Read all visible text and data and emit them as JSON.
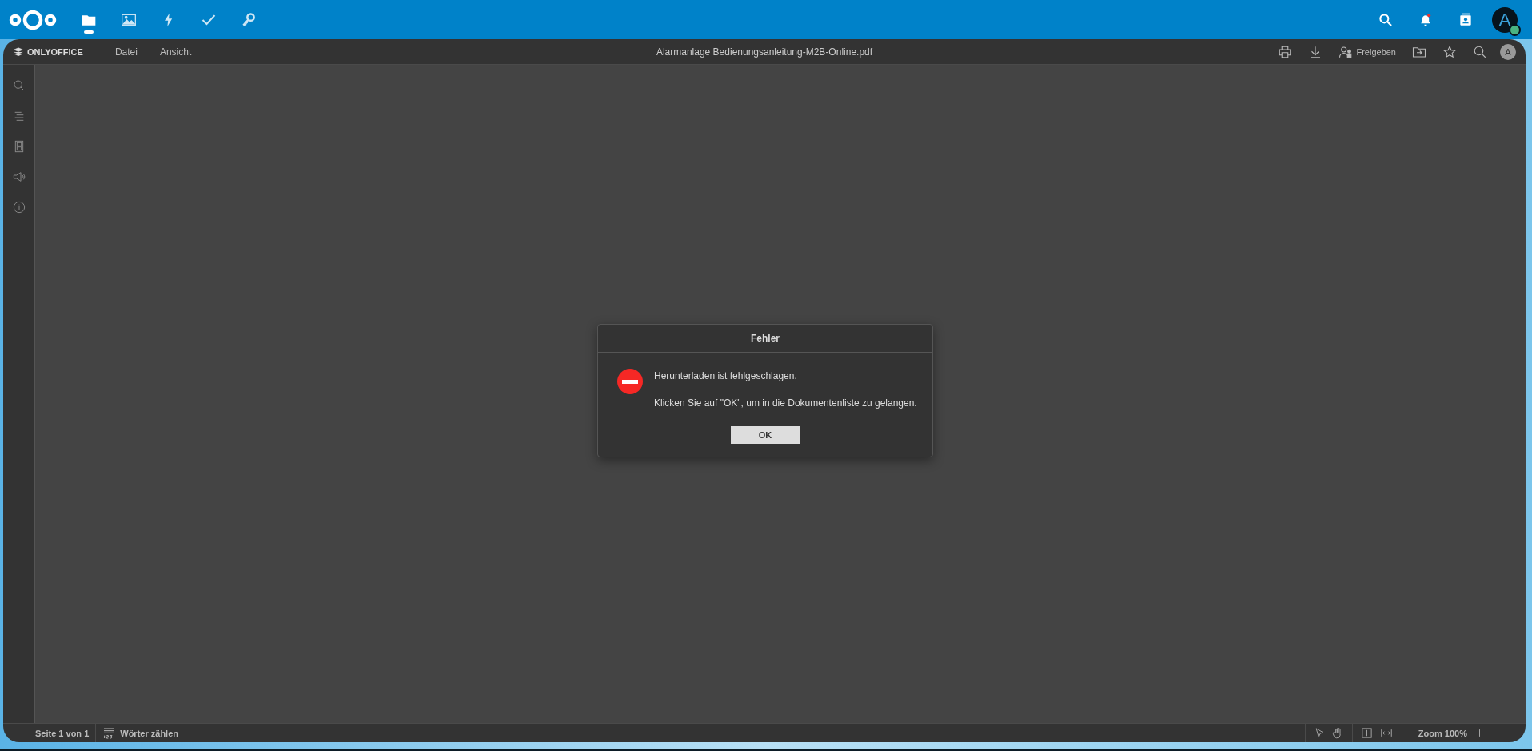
{
  "topbar": {
    "apps": [
      {
        "kind": "files",
        "selected": true
      },
      {
        "kind": "photos",
        "selected": false
      },
      {
        "kind": "activity",
        "selected": false
      },
      {
        "kind": "tasks",
        "selected": false
      },
      {
        "kind": "passwords",
        "selected": false
      }
    ],
    "avatar": "A"
  },
  "editor": {
    "logo": "ONLYOFFICE",
    "menus": [
      "Datei",
      "Ansicht"
    ],
    "title": "Alarmanlage Bedienungsanleitung-M2B-Online.pdf",
    "share_label": "Freigeben",
    "user": "A",
    "sidebar": [
      {
        "kind": "search"
      },
      {
        "kind": "outline"
      },
      {
        "kind": "thumbnails"
      },
      {
        "kind": "feedback"
      },
      {
        "kind": "info"
      }
    ],
    "status_bar": {
      "page": "Seite 1 von 1",
      "word_count": "Wörter zählen",
      "zoom": "Zoom 100%"
    }
  },
  "dialog": {
    "title": "Fehler",
    "messages": [
      "Herunterladen ist fehlgeschlagen.",
      "Klicken Sie auf \"OK\", um in die Dokumentenliste zu gelangen."
    ],
    "button": "OK"
  }
}
